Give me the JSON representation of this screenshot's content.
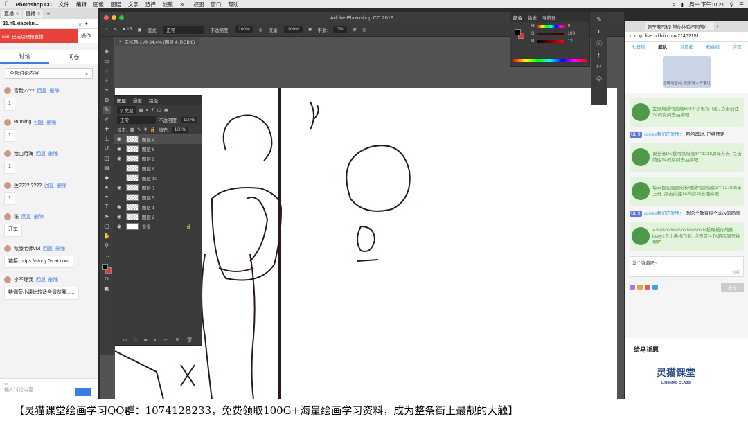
{
  "menubar": {
    "app": "Photoshop CC",
    "items": [
      "文件",
      "编辑",
      "图像",
      "图层",
      "文字",
      "选择",
      "滤镜",
      "3D",
      "视图",
      "窗口",
      "帮助"
    ],
    "clock": "周一 下午10:21"
  },
  "left_browser": {
    "tabs": [
      {
        "label": "直播"
      },
      {
        "label": "直播"
      }
    ],
    "url": "21.h5.xiaoekn...",
    "banner": "sun, 已成功预报直播",
    "banner_action": "操作",
    "panel_tabs": [
      "讨论",
      "问卷"
    ],
    "filter": "全部讨论内容",
    "messages": [
      {
        "name": "雪鞋????",
        "reply": "回复",
        "delete": "删除",
        "body": "1"
      },
      {
        "name": "BurNing",
        "reply": "回复",
        "delete": "删除",
        "body": "1"
      },
      {
        "name": "沧山月海",
        "reply": "回复",
        "delete": "删除",
        "body": "1"
      },
      {
        "name": "莲???? ????",
        "reply": "回复",
        "delete": "删除",
        "body": "1"
      },
      {
        "name": "张",
        "reply": "回复",
        "delete": "删除",
        "body": "开车"
      },
      {
        "name": "秋滕老师vivi",
        "reply": "回复",
        "delete": "删除",
        "body": "链接: https://study.0-cat.com"
      },
      {
        "name": "李不理我",
        "reply": "回复",
        "delete": "删除",
        "body": "特训营小课比较适合清贫我......"
      }
    ],
    "input_placeholder": "输入讨论内容"
  },
  "photoshop": {
    "window_title": "Adobe Photoshop CC 2019",
    "options": {
      "brush_size": "15",
      "mode_label": "模式:",
      "mode_value": "正常",
      "opacity_label": "不透明度:",
      "opacity_value": "100%",
      "flow_label": "流量:",
      "flow_value": "100%",
      "smooth_label": "平滑:",
      "smooth_value": "0%"
    },
    "doc_tab": "未标题-1 @ 34.4% (图层 4, RGB/8)",
    "layers_panel": {
      "tabs": [
        "图层",
        "通道",
        "路径"
      ],
      "kind_filter": "类型",
      "blend_mode": "正常",
      "opacity_label": "不透明度:",
      "opacity_value": "100%",
      "lock_label": "锁定:",
      "fill_label": "填充:",
      "fill_value": "100%",
      "layers": [
        {
          "name": "图层 4",
          "visible": true,
          "selected": true
        },
        {
          "name": "图层 6",
          "visible": true,
          "selected": false
        },
        {
          "name": "图层 9",
          "visible": true,
          "selected": false
        },
        {
          "name": "图层 8",
          "visible": false,
          "selected": false
        },
        {
          "name": "图层 10",
          "visible": false,
          "selected": false
        },
        {
          "name": "图层 7",
          "visible": true,
          "selected": false
        },
        {
          "name": "图层 5",
          "visible": false,
          "selected": false
        },
        {
          "name": "图层 1",
          "visible": true,
          "selected": false
        },
        {
          "name": "图层 2",
          "visible": true,
          "selected": false
        },
        {
          "name": "背景",
          "visible": true,
          "selected": false
        }
      ]
    },
    "color_panel": {
      "tabs": [
        "颜色",
        "色板",
        "导航器"
      ],
      "channels": [
        {
          "label": "H",
          "value": "0"
        },
        {
          "label": "S",
          "value": "100"
        },
        {
          "label": "B",
          "value": "12"
        }
      ]
    },
    "colors": {
      "foreground": "#000000",
      "background": "#e23a2e"
    }
  },
  "right_browser": {
    "tab": "佩车老司机! 带你体验不同的C...",
    "url": "live.bilibili.com/21462151",
    "nav": [
      "七日榜",
      "舰队",
      "发愿纪",
      "粉丝榜",
      "房管"
    ],
    "guard_caption": "正确设置的, 还没有人开通过",
    "chat": [
      {
        "type": "gift",
        "text": "金童角投喂战舰891个小电视飞船, 点击前往TA的房间去抽奖吧"
      },
      {
        "type": "danmu",
        "level": "UL 9",
        "name": "somax我们的爱情：",
        "text": "哈哈再进, 已经预定"
      },
      {
        "type": "gift",
        "text": "夜猫者DC投喂高级舰1个1218周年方舟, 点击前往TA的房间去抽奖吧"
      },
      {
        "type": "gift",
        "text": "每天都在画画的长嘘投喂高级舰1个1218周年方舟, 点击前往TA的房间去抽奖吧"
      },
      {
        "type": "danmu",
        "level": "UL 9",
        "name": "somax我们的爱情：",
        "text": "想念个歌直接个pixiv的画画"
      },
      {
        "type": "gift",
        "text": "ASWMWMWMWMWMWM投喂橘你的敷baby1个小电视飞船, 点击前往TA的房间去抽奖吧"
      }
    ],
    "input_text": "发个弹幕吧~",
    "input_count": "0/40",
    "send": "发送",
    "wish_title": "绘马祈愿",
    "logo_text": "灵猫课堂",
    "logo_sub": "LINGMAO CLASS"
  },
  "caption": "【灵猫课堂绘画学习QQ群：1074128233，免费领取100G+海量绘画学习资料，成为整条街上最靓的大触】"
}
